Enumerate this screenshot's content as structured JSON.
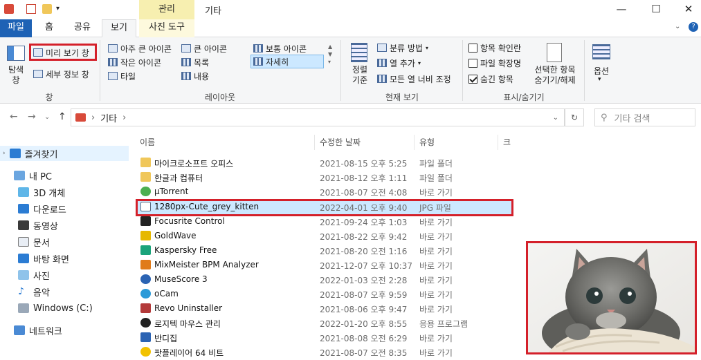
{
  "title_bar": {
    "manage_tab": "관리",
    "window_title": "기타",
    "minimize": "—",
    "maximize": "☐",
    "close": "✕"
  },
  "tabs": [
    {
      "label": "파일"
    },
    {
      "label": "홈"
    },
    {
      "label": "공유"
    },
    {
      "label": "보기"
    },
    {
      "label": "사진 도구"
    }
  ],
  "ribbon": {
    "pane_group": {
      "nav_pane": "탐색\n창",
      "preview_pane": "미리 보기 창",
      "details_pane": "세부 정보 창",
      "label": "창"
    },
    "layout_group": {
      "extra_large_icons": "아주 큰 아이콘",
      "large_icons": "큰 아이콘",
      "medium_icons": "보통 아이콘",
      "small_icons": "작은 아이콘",
      "list": "목록",
      "details": "자세히",
      "tiles": "타일",
      "content": "내용",
      "label": "레이아웃"
    },
    "current_view_group": {
      "sort_by": "정렬\n기준",
      "group_by": "분류 방법",
      "add_columns": "열 추가",
      "size_all_columns": "모든 열 너비 조정",
      "label": "현재 보기"
    },
    "show_hide_group": {
      "item_checkboxes": "항목 확인란",
      "file_name_extensions": "파일 확장명",
      "hidden_items": "숨긴 항목",
      "hide_selected": "선택한 항목\n숨기기/해제",
      "label": "표시/숨기기"
    },
    "options": "옵션"
  },
  "address": {
    "path": "기타",
    "search_placeholder": "기타 검색"
  },
  "nav_pane": {
    "items": [
      {
        "label": "즐겨찾기"
      },
      {
        "label": "내 PC"
      },
      {
        "label": "3D 개체"
      },
      {
        "label": "다운로드"
      },
      {
        "label": "동영상"
      },
      {
        "label": "문서"
      },
      {
        "label": "바탕 화면"
      },
      {
        "label": "사진"
      },
      {
        "label": "음악"
      },
      {
        "label": "Windows (C:)"
      },
      {
        "label": "네트워크"
      }
    ]
  },
  "columns": {
    "name": "이름",
    "date": "수정한 날짜",
    "type": "유형",
    "size": "크"
  },
  "files": [
    {
      "name": "마이크로소프트 오피스",
      "date": "2021-08-15 오후 5:25",
      "type": "파일 폴더"
    },
    {
      "name": "한글과 컴퓨터",
      "date": "2021-08-12 오후 1:11",
      "type": "파일 폴더"
    },
    {
      "name": "µTorrent",
      "date": "2021-08-07 오전 4:08",
      "type": "바로 가기"
    },
    {
      "name": "1280px-Cute_grey_kitten",
      "date": "2022-04-01 오후 9:40",
      "type": "JPG 파일"
    },
    {
      "name": "Focusrite Control",
      "date": "2021-09-24 오후 1:03",
      "type": "바로 가기"
    },
    {
      "name": "GoldWave",
      "date": "2021-08-22 오후 9:42",
      "type": "바로 가기"
    },
    {
      "name": "Kaspersky Free",
      "date": "2021-08-20 오전 1:16",
      "type": "바로 가기"
    },
    {
      "name": "MixMeister BPM Analyzer",
      "date": "2021-12-07 오후 10:37",
      "type": "바로 가기"
    },
    {
      "name": "MuseScore 3",
      "date": "2022-01-03 오전 2:28",
      "type": "바로 가기"
    },
    {
      "name": "oCam",
      "date": "2021-08-07 오후 9:59",
      "type": "바로 가기"
    },
    {
      "name": "Revo Uninstaller",
      "date": "2021-08-06 오후 9:47",
      "type": "바로 가기"
    },
    {
      "name": "로지텍 마우스 관리",
      "date": "2022-01-20 오후 8:55",
      "type": "응용 프로그램"
    },
    {
      "name": "반디집",
      "date": "2021-08-08 오전 6:29",
      "type": "바로 가기"
    },
    {
      "name": "팟플레이어 64 비트",
      "date": "2021-08-07 오전 8:35",
      "type": "바로 가기"
    }
  ],
  "colors": {
    "file_tab": "#1e62b5",
    "manage_tab": "#f7efb0",
    "selection": "#cce8ff",
    "highlight_red": "#d4202a",
    "folder": "#f0c75a"
  }
}
